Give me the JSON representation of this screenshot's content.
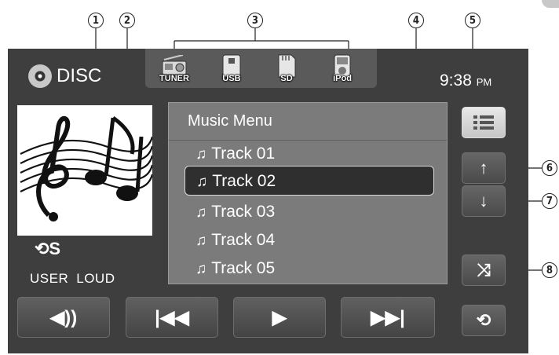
{
  "callouts": [
    "1",
    "2",
    "3",
    "4",
    "5",
    "6",
    "7",
    "8"
  ],
  "source": {
    "label": "DISC"
  },
  "sources": [
    {
      "label": "TUNER",
      "icon": "radio-icon"
    },
    {
      "label": "USB",
      "icon": "usb-icon"
    },
    {
      "label": "SD",
      "icon": "sd-card-icon"
    },
    {
      "label": "iPod",
      "icon": "ipod-icon"
    }
  ],
  "clock": {
    "time": "9:38",
    "ampm": "PM"
  },
  "status": {
    "repeat_glyph": "⟲S",
    "user": "USER",
    "loud": "LOUD"
  },
  "music_menu": {
    "title": "Music Menu",
    "note_glyph": "♫",
    "tracks": [
      "Track 01",
      "Track 02",
      "Track 03",
      "Track 04",
      "Track 05"
    ],
    "selected_index": 1
  },
  "side_buttons": {
    "up": "↑",
    "down": "↓",
    "shuffle": "⤨",
    "repeat": "⟲"
  },
  "bottom_buttons": {
    "volume": "◀))",
    "prev": "|◀◀",
    "play": "▶",
    "next": "▶▶|"
  }
}
